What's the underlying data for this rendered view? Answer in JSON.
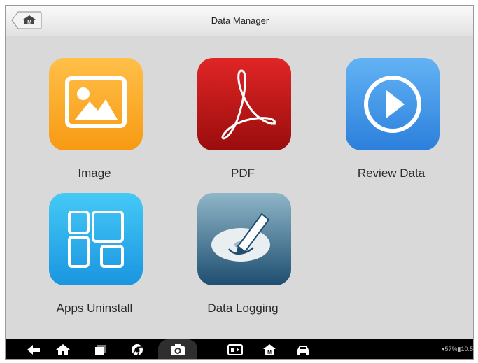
{
  "header": {
    "title": "Data Manager"
  },
  "tiles": [
    {
      "id": "image",
      "label": "Image",
      "icon": "image-icon",
      "color": "#f9a824"
    },
    {
      "id": "pdf",
      "label": "PDF",
      "icon": "pdf-icon",
      "color": "#c41b1b"
    },
    {
      "id": "review",
      "label": "Review Data",
      "icon": "play-icon",
      "color": "#3d8fe6"
    },
    {
      "id": "apps",
      "label": "Apps Uninstall",
      "icon": "apps-icon",
      "color": "#27aaeb"
    },
    {
      "id": "logging",
      "label": "Data Logging",
      "icon": "pen-disc-icon",
      "color": "#3b6f8e"
    }
  ],
  "navbar": {
    "icons": [
      "back-icon",
      "home-icon",
      "recent-apps-icon",
      "chrome-icon",
      "camera-icon",
      "screen-mirror-icon",
      "maxisys-home-icon",
      "car-icon"
    ],
    "status": {
      "battery": "57%",
      "time": "10:5"
    }
  }
}
